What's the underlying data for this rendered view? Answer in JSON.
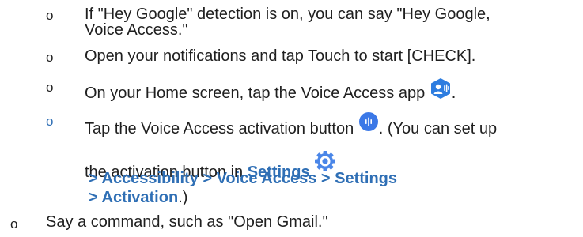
{
  "steps": {
    "bullet_symbol": "o",
    "hey_google": {
      "line1": "If \"Hey Google\" detection is on, you can say \"Hey Google,",
      "line2": "Voice Access.\""
    },
    "notifications": {
      "text": "Open your notifications and tap Touch to start [CHECK]."
    },
    "home_screen": {
      "text": "On your Home screen, tap the Voice Access app",
      "suffix": ".",
      "icon": "voice-access-app-icon"
    },
    "activation": {
      "line1_prefix": "Tap the Voice Access activation button",
      "line1_suffix": ". (You can set up",
      "line2_prefix": "the activation button in",
      "settings_link": "Settings",
      "line3": "> Accessibility > Voice Access > Settings",
      "line4_link": "> Activation",
      "line4_suffix": ".)",
      "button_icon": "activation-button-icon",
      "settings_icon": "settings-gear-icon"
    },
    "say_command": {
      "text": "Say a command, such as \"Open Gmail.\""
    }
  },
  "colors": {
    "text": "#1f1f1f",
    "link": "#2f6fb5",
    "icon_blue": "#4285f4"
  }
}
